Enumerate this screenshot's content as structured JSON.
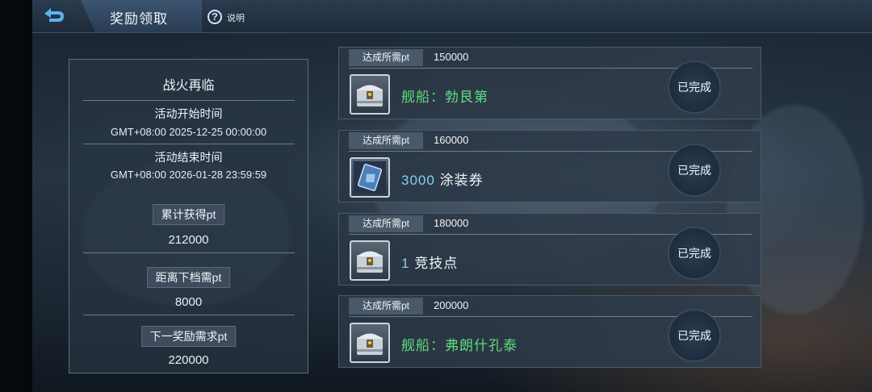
{
  "header": {
    "title": "奖励领取",
    "help_label": "说明"
  },
  "event": {
    "name": "战火再临",
    "start_label": "活动开始时间",
    "start_time": "GMT+08:00 2025-12-25 00:00:00",
    "end_label": "活动结束时间",
    "end_time": "GMT+08:00 2026-01-28 23:59:59"
  },
  "stats": {
    "total_label": "累计获得pt",
    "total_value": "212000",
    "remaining_label": "距离下档需pt",
    "remaining_value": "8000",
    "next_label": "下一奖励需求pt",
    "next_value": "220000"
  },
  "rewards": [
    {
      "req_label": "达成所需pt",
      "req_value": "150000",
      "prefix": "舰船：勃艮第",
      "amount": "",
      "name": "",
      "icon": "treasure-chest-icon",
      "status": "已完成"
    },
    {
      "req_label": "达成所需pt",
      "req_value": "160000",
      "prefix": "",
      "amount": "3000",
      "name": "涂装券",
      "icon": "skin-ticket-icon",
      "status": "已完成"
    },
    {
      "req_label": "达成所需pt",
      "req_value": "180000",
      "prefix": "",
      "amount": "1",
      "name": "竞技点",
      "icon": "treasure-chest-icon",
      "status": "已完成"
    },
    {
      "req_label": "达成所需pt",
      "req_value": "200000",
      "prefix": "舰船：弗朗什孔泰",
      "amount": "",
      "name": "",
      "icon": "treasure-chest-icon",
      "status": "已完成"
    }
  ],
  "colors": {
    "ship_reward": "#5fdc7a",
    "amount": "#7dd3f0",
    "panel_bg": "#28343f"
  }
}
